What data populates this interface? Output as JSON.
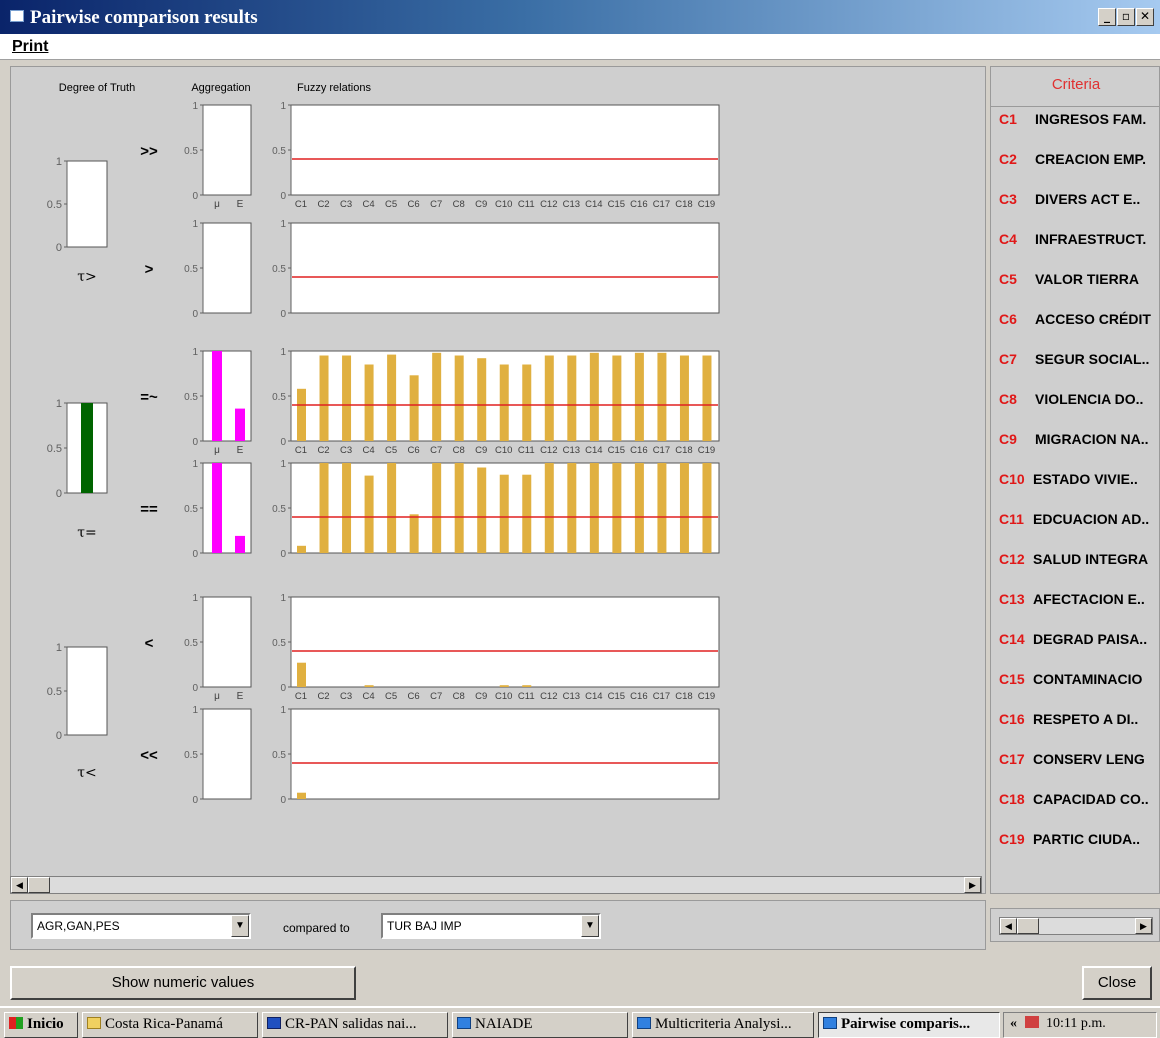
{
  "window": {
    "title": "Pairwise comparison results"
  },
  "menu": {
    "print": "Print"
  },
  "headers": {
    "degree": "Degree of Truth",
    "aggregation": "Aggregation",
    "fuzzy": "Fuzzy relations"
  },
  "chart_data": [
    {
      "type": "bar",
      "title": "Degree of Truth τ>",
      "categories": [
        "τ>"
      ],
      "values": [
        0
      ],
      "ylim": [
        0,
        1
      ],
      "yticks": [
        "0",
        "0.5",
        "1"
      ]
    },
    {
      "type": "bar",
      "title": "Degree of Truth τ=",
      "categories": [
        "τ="
      ],
      "values": [
        1.0
      ],
      "ylim": [
        0,
        1
      ],
      "yticks": [
        "0",
        "0.5",
        "1"
      ],
      "color": "#006400"
    },
    {
      "type": "bar",
      "title": "Degree of Truth τ<",
      "categories": [
        "τ<"
      ],
      "values": [
        0
      ],
      "ylim": [
        0,
        1
      ],
      "yticks": [
        "0",
        "0.5",
        "1"
      ]
    },
    {
      "type": "bar",
      "relation": ">>",
      "chart": "aggregation",
      "categories": [
        "μ",
        "E"
      ],
      "values": [
        0,
        0
      ],
      "ylim": [
        0,
        1
      ]
    },
    {
      "type": "bar",
      "relation": ">",
      "chart": "aggregation",
      "categories": [
        "μ",
        "E"
      ],
      "values": [
        0,
        0
      ],
      "ylim": [
        0,
        1
      ]
    },
    {
      "type": "bar",
      "relation": "=~",
      "chart": "aggregation",
      "categories": [
        "μ",
        "E"
      ],
      "values": [
        1.0,
        0.36
      ],
      "ylim": [
        0,
        1
      ],
      "color": "#ff00ff"
    },
    {
      "type": "bar",
      "relation": "==",
      "chart": "aggregation",
      "categories": [
        "μ",
        "E"
      ],
      "values": [
        1.0,
        0.19
      ],
      "ylim": [
        0,
        1
      ],
      "color": "#ff00ff"
    },
    {
      "type": "bar",
      "relation": "<",
      "chart": "aggregation",
      "categories": [
        "μ",
        "E"
      ],
      "values": [
        0,
        0
      ],
      "ylim": [
        0,
        1
      ]
    },
    {
      "type": "bar",
      "relation": "<<",
      "chart": "aggregation",
      "categories": [
        "μ",
        "E"
      ],
      "values": [
        0,
        0
      ],
      "ylim": [
        0,
        1
      ]
    },
    {
      "type": "bar",
      "relation": ">>",
      "chart": "fuzzy",
      "categories": [
        "C1",
        "C2",
        "C3",
        "C4",
        "C5",
        "C6",
        "C7",
        "C8",
        "C9",
        "C10",
        "C11",
        "C12",
        "C13",
        "C14",
        "C15",
        "C16",
        "C17",
        "C18",
        "C19"
      ],
      "values": [
        0,
        0,
        0,
        0,
        0,
        0,
        0,
        0,
        0,
        0,
        0,
        0,
        0,
        0,
        0,
        0,
        0,
        0,
        0
      ],
      "ylim": [
        0,
        1
      ],
      "threshold": 0.4,
      "color": "#e0b040"
    },
    {
      "type": "bar",
      "relation": ">",
      "chart": "fuzzy",
      "categories": [
        "C1",
        "C2",
        "C3",
        "C4",
        "C5",
        "C6",
        "C7",
        "C8",
        "C9",
        "C10",
        "C11",
        "C12",
        "C13",
        "C14",
        "C15",
        "C16",
        "C17",
        "C18",
        "C19"
      ],
      "values": [
        0,
        0,
        0,
        0,
        0,
        0,
        0,
        0,
        0,
        0,
        0,
        0,
        0,
        0,
        0,
        0,
        0,
        0,
        0
      ],
      "ylim": [
        0,
        1
      ],
      "threshold": 0.4,
      "color": "#e0b040"
    },
    {
      "type": "bar",
      "relation": "=~",
      "chart": "fuzzy",
      "categories": [
        "C1",
        "C2",
        "C3",
        "C4",
        "C5",
        "C6",
        "C7",
        "C8",
        "C9",
        "C10",
        "C11",
        "C12",
        "C13",
        "C14",
        "C15",
        "C16",
        "C17",
        "C18",
        "C19"
      ],
      "values": [
        0.58,
        0.95,
        0.95,
        0.85,
        0.96,
        0.73,
        0.98,
        0.95,
        0.92,
        0.85,
        0.85,
        0.95,
        0.95,
        0.98,
        0.95,
        0.98,
        0.98,
        0.95,
        0.95
      ],
      "ylim": [
        0,
        1
      ],
      "threshold": 0.4,
      "color": "#e0b040"
    },
    {
      "type": "bar",
      "relation": "==",
      "chart": "fuzzy",
      "categories": [
        "C1",
        "C2",
        "C3",
        "C4",
        "C5",
        "C6",
        "C7",
        "C8",
        "C9",
        "C10",
        "C11",
        "C12",
        "C13",
        "C14",
        "C15",
        "C16",
        "C17",
        "C18",
        "C19"
      ],
      "values": [
        0.08,
        1.0,
        1.0,
        0.86,
        1.0,
        0.43,
        1.0,
        1.0,
        0.95,
        0.87,
        0.87,
        1.0,
        1.0,
        1.0,
        1.0,
        1.0,
        1.0,
        1.0,
        1.0
      ],
      "ylim": [
        0,
        1
      ],
      "threshold": 0.4,
      "color": "#e0b040"
    },
    {
      "type": "bar",
      "relation": "<",
      "chart": "fuzzy",
      "categories": [
        "C1",
        "C2",
        "C3",
        "C4",
        "C5",
        "C6",
        "C7",
        "C8",
        "C9",
        "C10",
        "C11",
        "C12",
        "C13",
        "C14",
        "C15",
        "C16",
        "C17",
        "C18",
        "C19"
      ],
      "values": [
        0.27,
        0,
        0,
        0.02,
        0,
        0,
        0,
        0,
        0,
        0.02,
        0.02,
        0,
        0,
        0,
        0,
        0,
        0,
        0,
        0
      ],
      "ylim": [
        0,
        1
      ],
      "threshold": 0.4,
      "color": "#e0b040"
    },
    {
      "type": "bar",
      "relation": "<<",
      "chart": "fuzzy",
      "categories": [
        "C1",
        "C2",
        "C3",
        "C4",
        "C5",
        "C6",
        "C7",
        "C8",
        "C9",
        "C10",
        "C11",
        "C12",
        "C13",
        "C14",
        "C15",
        "C16",
        "C17",
        "C18",
        "C19"
      ],
      "values": [
        0.07,
        0,
        0,
        0,
        0,
        0,
        0,
        0,
        0,
        0,
        0,
        0,
        0,
        0,
        0,
        0,
        0,
        0,
        0
      ],
      "ylim": [
        0,
        1
      ],
      "threshold": 0.4,
      "color": "#e0b040"
    }
  ],
  "criteria": {
    "header": "Criteria",
    "items": [
      {
        "code": "C1",
        "name": "INGRESOS FAM."
      },
      {
        "code": "C2",
        "name": "CREACION EMP."
      },
      {
        "code": "C3",
        "name": "DIVERS ACT E.."
      },
      {
        "code": "C4",
        "name": "INFRAESTRUCT."
      },
      {
        "code": "C5",
        "name": "VALOR TIERRA"
      },
      {
        "code": "C6",
        "name": "ACCESO CRÉDIT"
      },
      {
        "code": "C7",
        "name": "SEGUR SOCIAL.."
      },
      {
        "code": "C8",
        "name": "VIOLENCIA DO.."
      },
      {
        "code": "C9",
        "name": "MIGRACION NA.."
      },
      {
        "code": "C10",
        "name": "ESTADO VIVIE.."
      },
      {
        "code": "C11",
        "name": "EDCUACION AD.."
      },
      {
        "code": "C12",
        "name": "SALUD INTEGRA"
      },
      {
        "code": "C13",
        "name": "AFECTACION E.."
      },
      {
        "code": "C14",
        "name": "DEGRAD PAISA.."
      },
      {
        "code": "C15",
        "name": "CONTAMINACIO"
      },
      {
        "code": "C16",
        "name": "RESPETO A DI.."
      },
      {
        "code": "C17",
        "name": "CONSERV LENG"
      },
      {
        "code": "C18",
        "name": "CAPACIDAD CO.."
      },
      {
        "code": "C19",
        "name": "PARTIC CIUDA.."
      }
    ]
  },
  "comparison": {
    "left": "AGR,GAN,PES",
    "compared_to": "compared to",
    "right": "TUR BAJ IMP"
  },
  "buttons": {
    "show_numeric": "Show numeric values",
    "close": "Close"
  },
  "taskbar": {
    "start": "Inicio",
    "tasks": [
      "Costa Rica-Panamá",
      "CR-PAN salidas nai...",
      "NAIADE",
      "Multicriteria Analysi...",
      "Pairwise comparis..."
    ],
    "time": "10:11 p.m."
  }
}
